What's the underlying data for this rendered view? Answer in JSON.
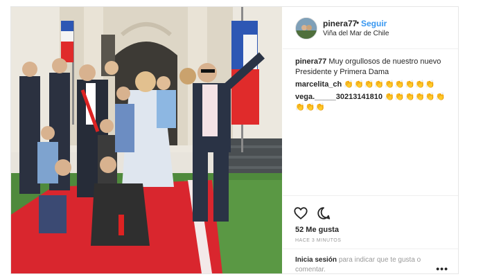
{
  "post": {
    "username": "pinera77",
    "separator": "•",
    "follow_label": "Seguir",
    "location": "Viña del Mar de Chile",
    "caption_user": "pinera77",
    "caption_text": "Muy orgullosos de nuestro nuevo Presidente y Primera Dama",
    "comments": [
      {
        "user": "marcelita_ch",
        "text": "👏👏👏👏👏👏👏👏👏"
      },
      {
        "user": "vega._____30213141810",
        "text": "👏👏👏👏👏👏👏👏👏"
      }
    ],
    "likes": "52 Me gusta",
    "timestamp": "HACE 3 MINUTOS",
    "login_link": "Inicia sesión",
    "login_text": "para indicar que te gusta o comentar.",
    "more_label": "•••"
  },
  "icons": {
    "like": "heart-icon",
    "comment": "comment-icon",
    "more": "more-options-icon"
  },
  "colors": {
    "link_blue": "#3897f0",
    "carpet_red": "#d9262e",
    "text": "#262626",
    "muted": "#999999"
  }
}
